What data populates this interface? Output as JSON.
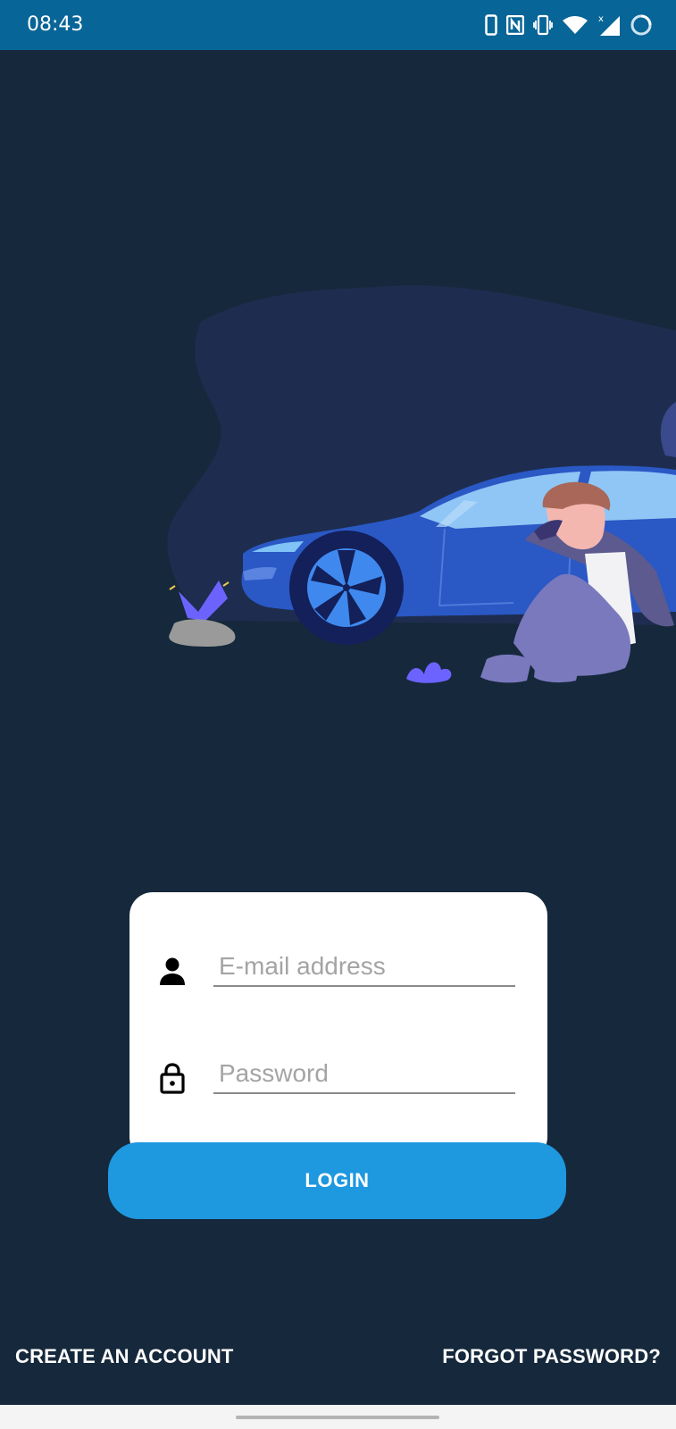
{
  "status_bar": {
    "time": "08:43",
    "icons": [
      "phone-icon",
      "nfc-icon",
      "vibrate-icon",
      "wifi-icon",
      "signal-icon",
      "battery-icon"
    ]
  },
  "illustration": {
    "name": "car-with-person-illustration",
    "colors": {
      "background": "#16283B",
      "blob": "#1E2D4F",
      "car_body": "#2A58C5",
      "car_window": "#8FC6F5",
      "wheel": "#3F89EE",
      "accent_purple": "#6C63FF"
    }
  },
  "form": {
    "email": {
      "placeholder": "E-mail address",
      "value": ""
    },
    "password": {
      "placeholder": "Password",
      "value": ""
    }
  },
  "login_button": {
    "label": "LOGIN",
    "color": "#1E98DF"
  },
  "links": {
    "create_account": "CREATE AN ACCOUNT",
    "forgot_password": "FORGOT PASSWORD?"
  }
}
